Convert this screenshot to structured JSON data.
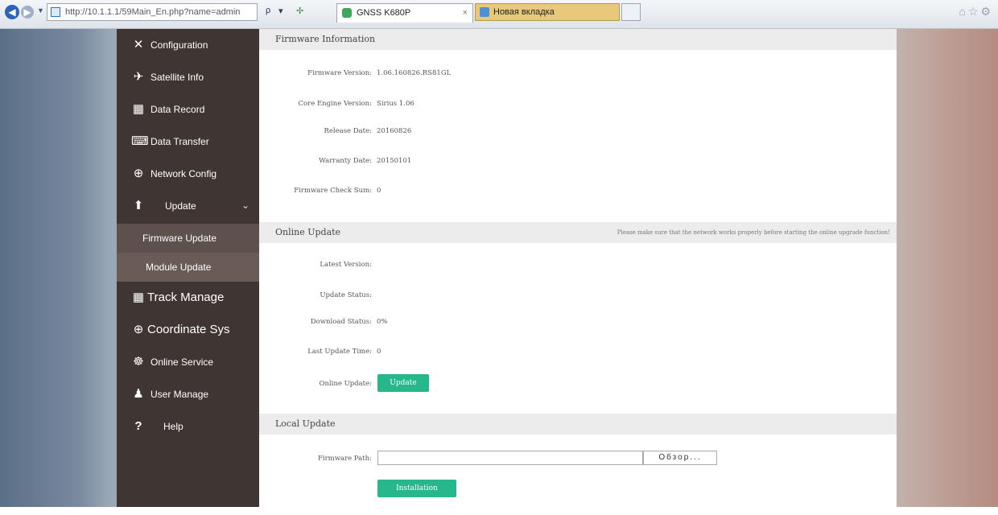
{
  "browser": {
    "url": "http://10.1.1.1/59Main_En.php?name=admin",
    "address_tools": {
      "search_glyph": "ρ",
      "dropdown_glyph": "▾",
      "refresh_glyph": "✢"
    },
    "tabs": [
      {
        "title": "GNSS K680P",
        "close_glyph": "×"
      },
      {
        "title": "Новая вкладка"
      }
    ],
    "right_icons": "⌂☆⚙"
  },
  "sidebar": {
    "items": [
      {
        "label": "Configuration",
        "icon": "✕"
      },
      {
        "label": "Satellite Info",
        "icon": "✈"
      },
      {
        "label": "Data Record",
        "icon": "▦"
      },
      {
        "label": "Data Transfer",
        "icon": "⌨"
      },
      {
        "label": "Network Config",
        "icon": "⊕"
      },
      {
        "label": "Update",
        "icon": "⬆",
        "caret": "⌄"
      }
    ],
    "sub_items": [
      {
        "label": "Firmware Update"
      },
      {
        "label": "Module Update"
      }
    ],
    "items_after": [
      {
        "label": "Track Manage",
        "icon": "▦"
      },
      {
        "label": "Coordinate Sys",
        "icon": "⊕"
      },
      {
        "label": "Online Service",
        "icon": "☸"
      },
      {
        "label": "User Manage",
        "icon": "♟"
      },
      {
        "label": "Help",
        "icon": "?"
      }
    ]
  },
  "firmware_info": {
    "title": "Firmware Information",
    "rows": [
      {
        "label": "Firmware Version:",
        "value": "1.06.160826.RS81GL"
      },
      {
        "label": "Core Engine Version:",
        "value": "Sirius 1.06"
      },
      {
        "label": "Release Date:",
        "value": "20160826"
      },
      {
        "label": "Warranty Date:",
        "value": "20150101"
      },
      {
        "label": "Firmware Check Sum:",
        "value": "0"
      }
    ]
  },
  "online_update": {
    "title": "Online Update",
    "note": "Please make sure that the network works properly before starting the online upgrade function!",
    "rows": [
      {
        "label": "Latest Version:",
        "value": ""
      },
      {
        "label": "Update Status:",
        "value": ""
      },
      {
        "label": "Download Status:",
        "value": "0%"
      },
      {
        "label": "Last Update Time:",
        "value": "0"
      }
    ],
    "action_label": "Online Update:",
    "button": "Update"
  },
  "local_update": {
    "title": "Local Update",
    "path_label": "Firmware Path:",
    "path_value": "",
    "browse_button": "Обзор...",
    "install_button": "Installation"
  },
  "colors": {
    "sidebar": "#3f3532",
    "submenu": "#6a5b57",
    "accent": "#26b88c"
  }
}
